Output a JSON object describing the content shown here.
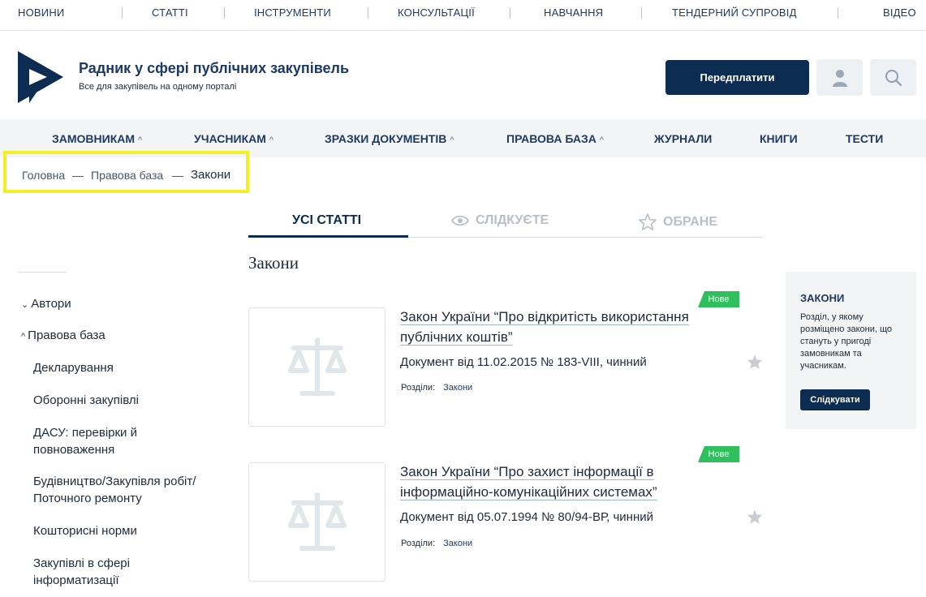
{
  "top_nav": [
    "НОВИНИ",
    "СТАТТІ",
    "ІНСТРУМЕНТИ",
    "КОНСУЛЬТАЦІЇ",
    "НАВЧАННЯ",
    "ТЕНДЕРНИЙ СУПРОВІД",
    "ВІДЕО"
  ],
  "header": {
    "title": "Радник у сфері публічних закупівель",
    "subtitle": "Все для закупівель на одному порталі",
    "subscribe_label": "Передплатити",
    "user_icon": "user-icon",
    "search_icon": "search-icon"
  },
  "main_nav": [
    "ЗАМОВНИКАМ",
    "УЧАСНИКАМ",
    "ЗРАЗКИ ДОКУМЕНТІВ",
    "ПРАВОВА БАЗА",
    "ЖУРНАЛИ",
    "КНИГИ",
    "ТЕСТИ"
  ],
  "main_nav_chevron": "^",
  "breadcrumb": {
    "items": [
      "Головна",
      "Правова база"
    ],
    "separator": "—",
    "current": "Закони"
  },
  "tabs": [
    "УСІ СТАТТІ",
    "СЛІДКУЄТЕ",
    "ОБРАНЕ"
  ],
  "page_heading": "Закони",
  "sidebar": {
    "sections": [
      "Автори",
      "Правова база"
    ],
    "items": [
      "Декларування",
      "Оборонні закупівлі",
      "ДАСУ: перевірки й повноваження",
      "Будівництво/Закупівля робіт/ Поточного ремонту",
      "Кошторисні норми",
      "Закупівлі в сфері інформатизації"
    ]
  },
  "articles": [
    {
      "badge": "Нове",
      "title": "Закон України “Про відкритість використання публічних коштів”",
      "doc": "Документ від 11.02.2015 № 183-VIII, чинний",
      "sections_label": "Розділи:",
      "section_link": "Закони"
    },
    {
      "badge": "Нове",
      "title": "Закон України “Про захист інформації в інформаційно-комунікаційних системах”",
      "doc": "Документ від 05.07.1994 № 80/94-ВР, чинний",
      "sections_label": "Розділи:",
      "section_link": "Закони"
    }
  ],
  "info_panel": {
    "title": "ЗАКОНИ",
    "text": "Розділ, у якому розміщено закони, що стануть у пригоді замовникам та учасникам.",
    "button": "Слідкувати"
  },
  "colors": {
    "brand_navy": "#0d2c52",
    "badge_green": "#2fc05d",
    "highlight_yellow": "#f4ee25",
    "panel_bg": "#f2f4f5"
  }
}
